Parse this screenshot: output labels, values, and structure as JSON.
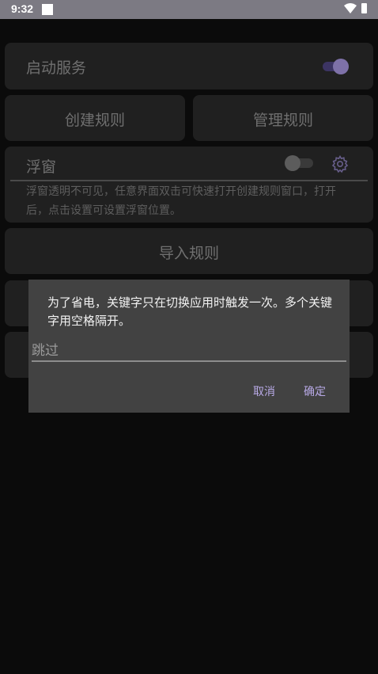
{
  "status_bar": {
    "time": "9:32"
  },
  "main": {
    "service": {
      "label": "启动服务",
      "enabled": true
    },
    "create_rule_label": "创建规则",
    "manage_rule_label": "管理规则",
    "float_window": {
      "label": "浮窗",
      "enabled": false,
      "hint": "浮窗透明不可见，任意界面双击可快速打开创建规则窗口，打开后，点击设置可设置浮窗位置。"
    },
    "import_rule_label": "导入规则"
  },
  "dialog": {
    "message": "为了省电，关键字只在切换应用时触发一次。多个关键字用空格隔开。",
    "input_value": "跳过",
    "cancel_label": "取消",
    "confirm_label": "确定"
  },
  "colors": {
    "accent": "#b8a9e6",
    "toggle_on_thumb": "#7e71a8",
    "toggle_on_track": "#3c3463",
    "status_bar": "#7c7a83",
    "card": "#202020",
    "dialog": "#424242"
  }
}
